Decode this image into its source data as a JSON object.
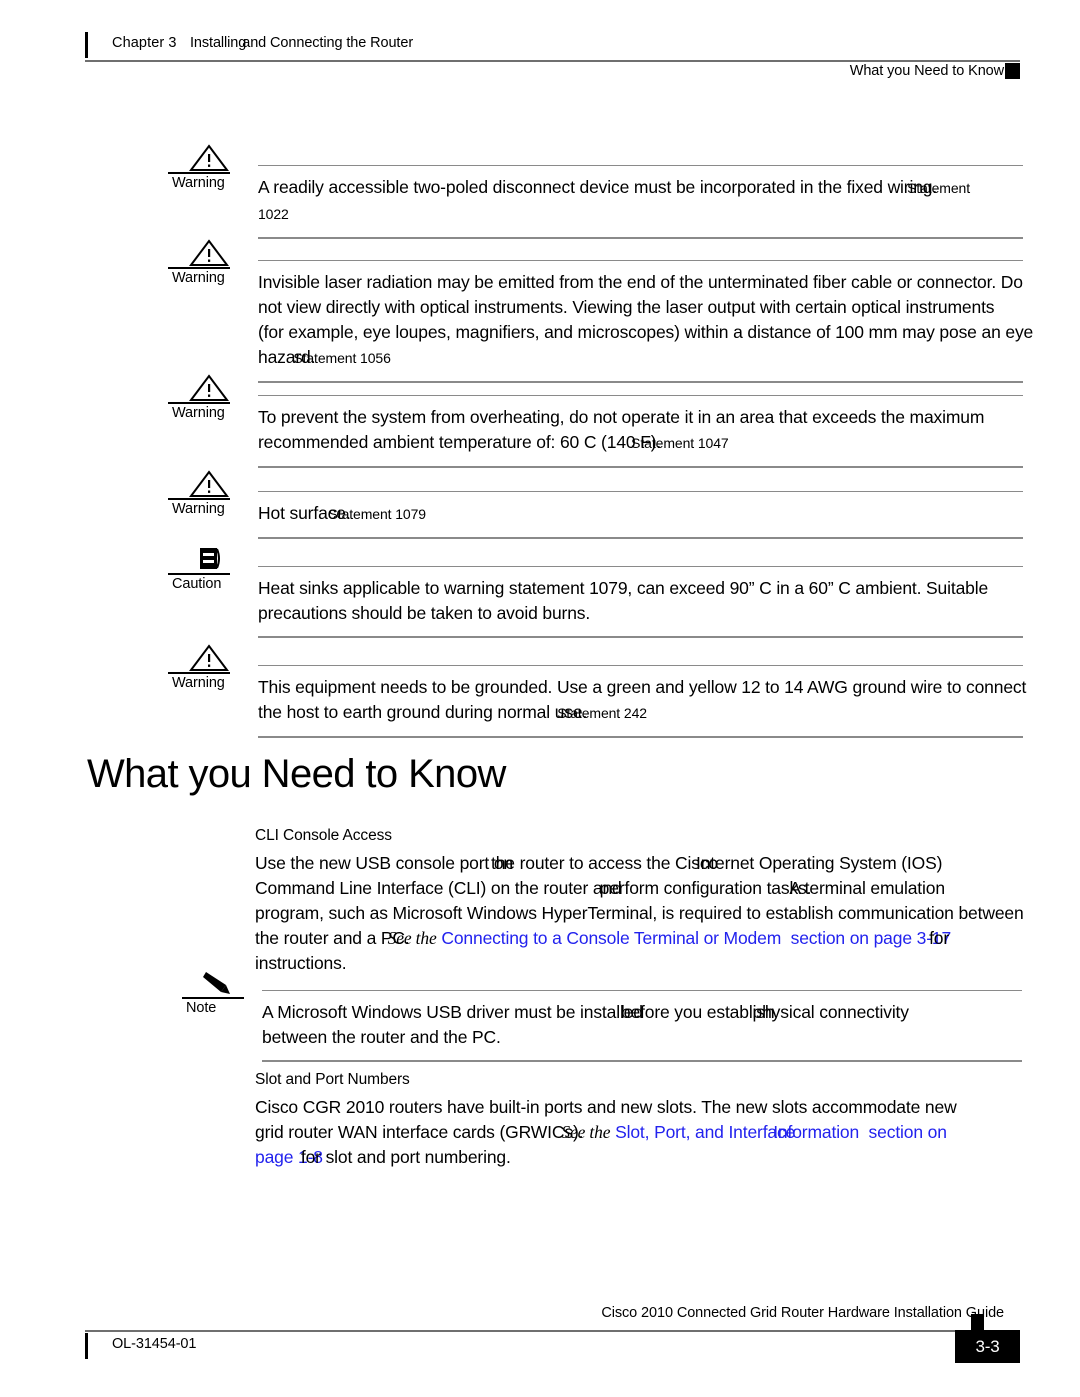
{
  "header": {
    "chapter": "Chapter 3",
    "chapter_title_a": "Installing",
    "chapter_title_b": "and Connecting the Router",
    "section": "What you Need to Know"
  },
  "admonitions": [
    {
      "icon": "warning-triangle-icon",
      "label": "Warning",
      "lines": [
        "A readily accessible two-poled disconnect device must be incorporated in the fixed wiring."
      ],
      "statement_inline": "Statement",
      "statement_next_line": "1022"
    },
    {
      "icon": "warning-triangle-icon",
      "label": "Warning",
      "lines": [
        "Invisible laser radiation may be emitted from the end of the unterminated fiber cable or connector. Do",
        "not view directly with optical instruments. Viewing the laser output with certain optical instruments",
        "(for example, eye loupes, magnifiers, and microscopes) within a distance of 100 mm may pose an eye",
        "hazard."
      ],
      "statement_inline": "Statement 1056"
    },
    {
      "icon": "warning-triangle-icon",
      "label": "Warning",
      "lines": [
        "To prevent the system from overheating, do not operate it in an area that exceeds the maximum",
        "recommended ambient temperature of: 60 C (140 F)."
      ],
      "statement_inline": "Statement 1047"
    },
    {
      "icon": "warning-triangle-icon",
      "label": "Warning",
      "lines": [
        "Hot surface."
      ],
      "statement_inline": "Statement 1079"
    },
    {
      "icon": "caution-block-icon",
      "label": "Caution",
      "lines": [
        "Heat sinks applicable to warning statement 1079, can exceed 90” C in a 60” C ambient. Suitable",
        "precautions should be taken to avoid burns."
      ],
      "statement_inline": ""
    },
    {
      "icon": "warning-triangle-icon",
      "label": "Warning",
      "lines": [
        "This equipment needs to be grounded. Use a green and yellow 12 to 14 AWG ground wire to connect",
        "the host to earth ground during normal use."
      ],
      "statement_inline": "Statement 242"
    }
  ],
  "main": {
    "heading": "What you Need to Know",
    "cli_section": {
      "subhead": "CLI Console Access",
      "l1_a": "Use the new USB console port on",
      "l1_b": "the router to access the Cisco",
      "l1_c": "Internet Operating System (IOS)",
      "l2_a": "Command Line Interface (CLI) on the router and",
      "l2_b": "perform configuration tasks.",
      "l2_c": "A terminal emulation",
      "l3": "program, such as Microsoft Windows HyperTerminal, is required to establish communication between",
      "l4_a": "the router and a PC.",
      "l4_b": "See the",
      "l4_link": "Connecting to a Console Terminal or Modem",
      "l4_c": "section on page",
      "l4_page": "3-17",
      "l4_for": "for",
      "l5": "instructions."
    },
    "note": {
      "icon": "note-pencil-icon",
      "label": "Note",
      "l1_a": "A Microsoft Windows USB driver must be installed",
      "l1_b": "before you establish",
      "l1_c": "physical connectivity",
      "l2": "between the router and the PC."
    },
    "slot_section": {
      "subhead": "Slot and Port Numbers",
      "l1": "Cisco CGR 2010 routers have built-in ports and new slots. The new slots accommodate new",
      "l2_a": "grid router WAN interface cards (GRWICs).",
      "l2_b": "See the",
      "l2_link_a": "Slot, Port, and Interface",
      "l2_link_b": "Information",
      "l2_link_c": "section on",
      "l3_link": "page 1-8",
      "l3_rest": "for slot and port numbering."
    }
  },
  "footer": {
    "doc_title": "Cisco 2010  Connected Grid Router Hardware Installation Guide",
    "doc_id": "OL-31454-01",
    "page_number": "3-3"
  },
  "colors": {
    "link": "#2222ee",
    "rule": "#8a8a8a",
    "text": "#000000"
  }
}
